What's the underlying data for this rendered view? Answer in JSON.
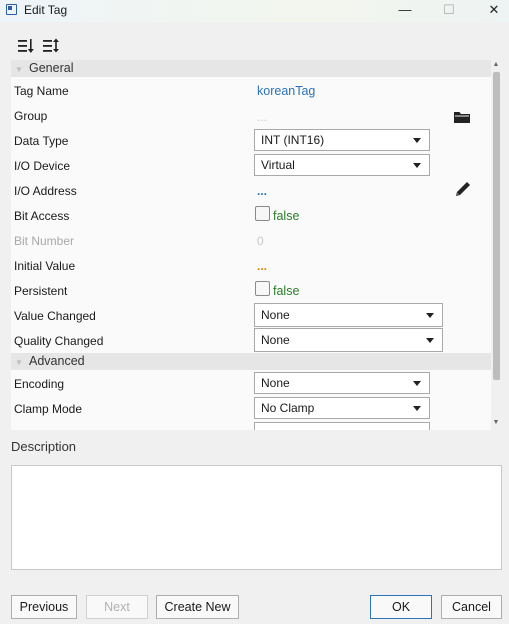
{
  "window": {
    "title": "Edit Tag",
    "minimize_glyph": "—",
    "maximize_glyph": "☐",
    "close_glyph": "✕"
  },
  "toolbar": {
    "sort_icon": "sort-categorized-icon",
    "sort_alpha_icon": "sort-alphabetical-icon"
  },
  "sections": {
    "general": "General",
    "advanced": "Advanced"
  },
  "general": {
    "tag_name_label": "Tag Name",
    "tag_name_value": "koreanTag",
    "group_label": "Group",
    "group_value": "...",
    "data_type_label": "Data Type",
    "data_type_value": "INT (INT16)",
    "io_device_label": "I/O Device",
    "io_device_value": "Virtual",
    "io_address_label": "I/O Address",
    "io_address_value": "...",
    "bit_access_label": "Bit Access",
    "bit_access_value": "false",
    "bit_number_label": "Bit Number",
    "bit_number_value": "0",
    "initial_value_label": "Initial Value",
    "initial_value_value": "...",
    "persistent_label": "Persistent",
    "persistent_value": "false",
    "value_changed_label": "Value Changed",
    "value_changed_value": "None",
    "quality_changed_label": "Quality Changed",
    "quality_changed_value": "None"
  },
  "advanced": {
    "encoding_label": "Encoding",
    "encoding_value": "None",
    "clamp_mode_label": "Clamp Mode",
    "clamp_mode_value": "No Clamp"
  },
  "description": {
    "label": "Description",
    "value": ""
  },
  "buttons": {
    "previous": "Previous",
    "next": "Next",
    "create_new": "Create New",
    "ok": "OK",
    "cancel": "Cancel"
  },
  "colors": {
    "link_blue": "#2a73b8",
    "false_green": "#2a7d2a",
    "dots_orange": "#e08a00"
  }
}
